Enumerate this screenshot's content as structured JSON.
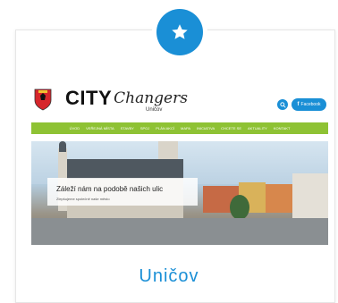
{
  "badge": {
    "icon": "star-icon",
    "color": "#1a8fd6"
  },
  "site": {
    "brand_city": "CITY",
    "brand_changers": "Changers",
    "brand_sub": "Uničov",
    "facebook_label": "Facebook",
    "accent": "#1a8fd6",
    "nav_color": "#8ec234"
  },
  "nav": {
    "items": [
      "ÚVOD",
      "VEŘEJNÁ MÍSTA",
      "STAVBY",
      "SPOJ",
      "PLÁN AKCÍ",
      "MAPA",
      "INICIATIVA",
      "CHCETE SE",
      "AKTUALITY",
      "KONTAKT"
    ]
  },
  "hero": {
    "title": "Záleží nám na podobě našich ulic",
    "subtitle": "Zlepšujeme společně naše město"
  },
  "card": {
    "city_name": "Uničov"
  }
}
